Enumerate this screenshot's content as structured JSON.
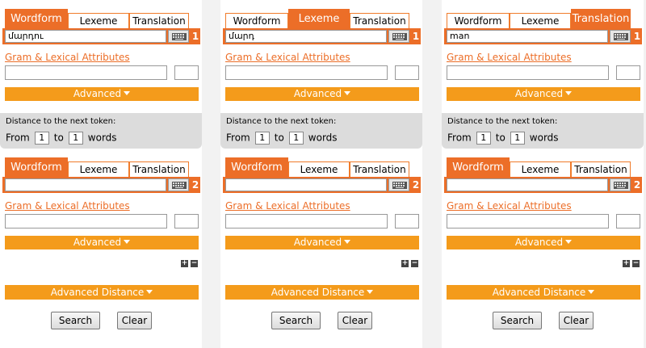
{
  "tab_labels": {
    "wordform": "Wordform",
    "lexeme": "Lexeme",
    "translation": "Translation"
  },
  "gram_label": "Gram & Lexical Attributes",
  "advanced_label": "Advanced",
  "distance": {
    "title": "Distance to the next token:",
    "from_label": "From",
    "to_label": "to",
    "words_label": "words",
    "from_value": "1",
    "to_value": "1"
  },
  "advanced_distance_label": "Advanced Distance",
  "plus_label": "+",
  "minus_label": "−",
  "search_label": "Search",
  "clear_label": "Clear",
  "accent_color": "#ec6e28",
  "button_color": "#f49b1b",
  "panels": [
    {
      "tokens": [
        {
          "active_tab": "Wordform",
          "value": "մարդու",
          "number": "1"
        },
        {
          "active_tab": "Wordform",
          "value": "",
          "number": "2"
        }
      ]
    },
    {
      "tokens": [
        {
          "active_tab": "Lexeme",
          "value": "մարդ",
          "number": "1"
        },
        {
          "active_tab": "Wordform",
          "value": "",
          "number": "2"
        }
      ]
    },
    {
      "tokens": [
        {
          "active_tab": "Translation",
          "value": "man",
          "number": "1"
        },
        {
          "active_tab": "Wordform",
          "value": "",
          "number": "2"
        }
      ]
    }
  ]
}
